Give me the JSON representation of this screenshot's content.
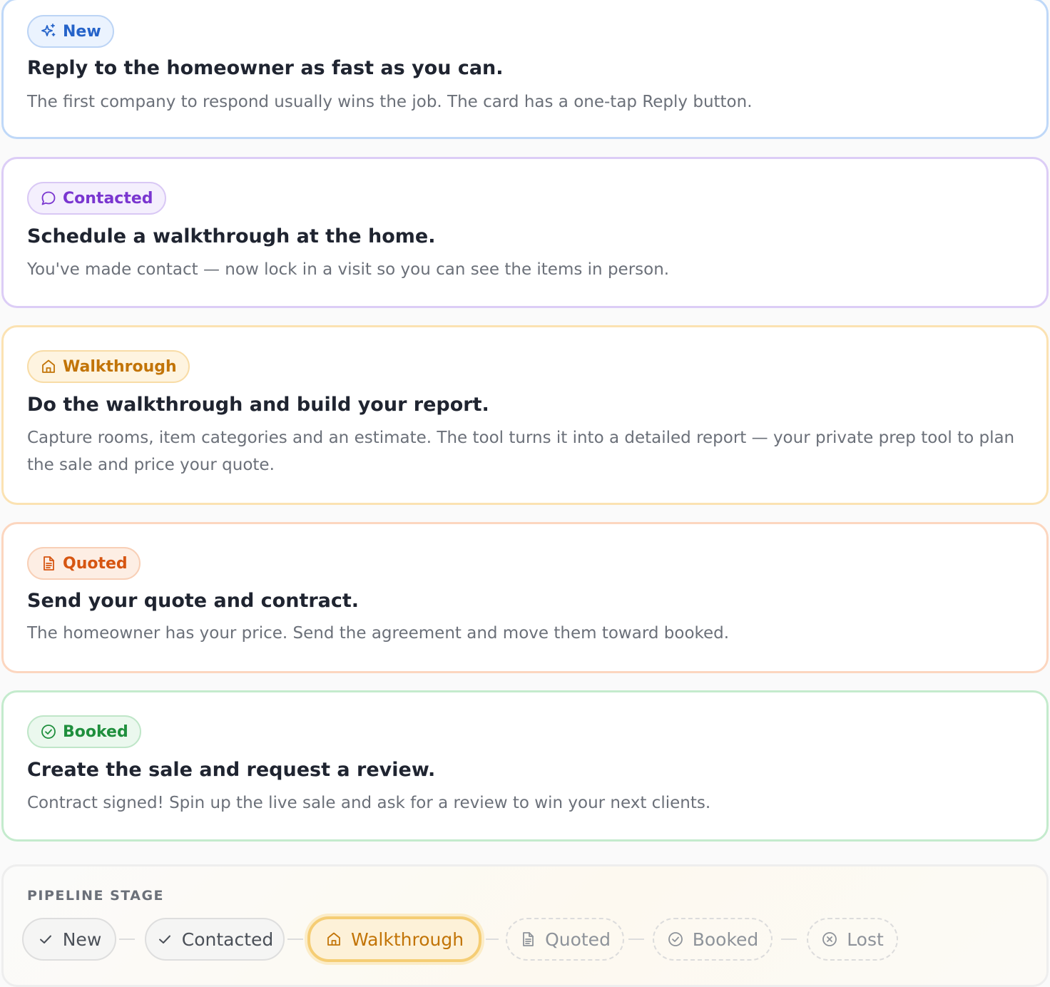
{
  "cards": [
    {
      "badge": "New",
      "icon": "sparkles-icon",
      "title": "Reply to the homeowner as fast as you can.",
      "description": "The first company to respond usually wins the job. The card has a one-tap Reply button.",
      "colors": {
        "border": "#bfd8f8",
        "badge_bg": "#ebf3fe",
        "badge_border": "#bcd4f5",
        "text": "#2563c9"
      }
    },
    {
      "badge": "Contacted",
      "icon": "chat-bubble-icon",
      "title": "Schedule a walkthrough at the home.",
      "description": "You've made contact — now lock in a visit so you can see the items in person.",
      "colors": {
        "border": "#dccdf6",
        "badge_bg": "#f4effd",
        "badge_border": "#d9c8f5",
        "text": "#7a36d0"
      }
    },
    {
      "badge": "Walkthrough",
      "icon": "home-icon",
      "title": "Do the walkthrough and build your report.",
      "description": "Capture rooms, item categories and an estimate. The tool turns it into a detailed report — your private prep tool to plan the sale and price your quote.",
      "colors": {
        "border": "#fbe2b2",
        "badge_bg": "#fef4e0",
        "badge_border": "#f8dca6",
        "text": "#c27407"
      }
    },
    {
      "badge": "Quoted",
      "icon": "document-icon",
      "title": "Send your quote and contract.",
      "description": "The homeowner has your price. Send the agreement and move them toward booked.",
      "colors": {
        "border": "#fcd6bf",
        "badge_bg": "#fdeee4",
        "badge_border": "#f8cfb6",
        "text": "#d65511"
      }
    },
    {
      "badge": "Booked",
      "icon": "check-circle-icon",
      "title": "Create the sale and request a review.",
      "description": "Contract signed! Spin up the live sale and ask for a review to win your next clients.",
      "colors": {
        "border": "#c4ebcd",
        "badge_bg": "#ebf8ee",
        "badge_border": "#bfe6c8",
        "text": "#1f8f3d"
      }
    }
  ],
  "pipeline": {
    "label": "PIPELINE STAGE",
    "stages": [
      {
        "label": "New",
        "state": "done",
        "icon": "check-icon"
      },
      {
        "label": "Contacted",
        "state": "done",
        "icon": "check-icon"
      },
      {
        "label": "Walkthrough",
        "state": "active",
        "icon": "home-icon"
      },
      {
        "label": "Quoted",
        "state": "todo",
        "icon": "document-icon"
      },
      {
        "label": "Booked",
        "state": "todo",
        "icon": "check-circle-icon"
      },
      {
        "label": "Lost",
        "state": "todo",
        "icon": "x-circle-icon"
      }
    ]
  }
}
